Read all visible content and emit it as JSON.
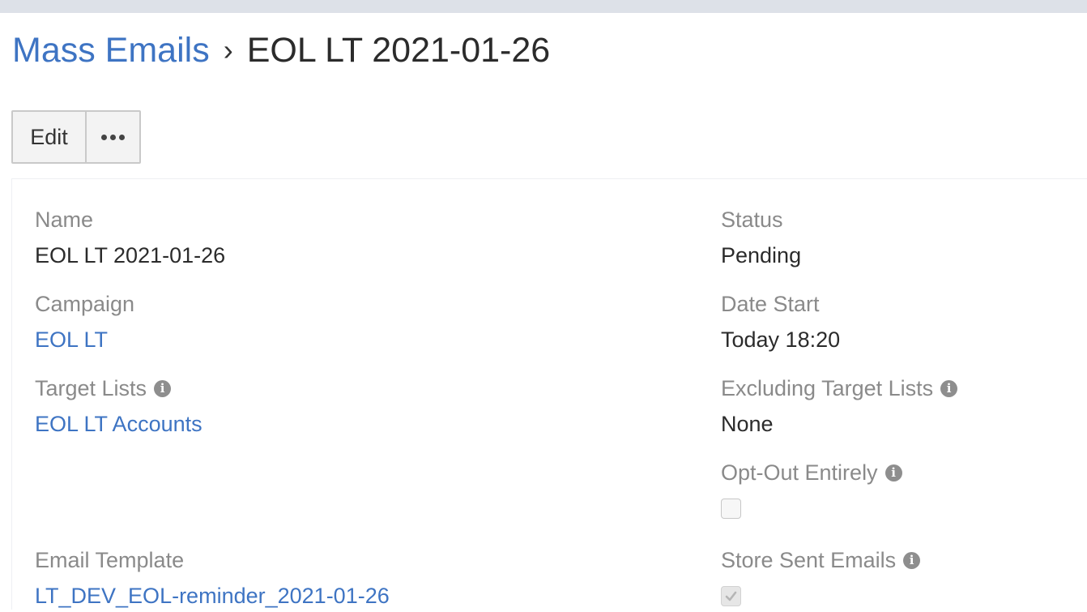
{
  "breadcrumb": {
    "parent_label": "Mass Emails",
    "separator": "›",
    "current_label": "EOL LT 2021-01-26"
  },
  "toolbar": {
    "edit_label": "Edit",
    "more_icon": "ellipsis-icon"
  },
  "fields": {
    "name": {
      "label": "Name",
      "value": "EOL LT 2021-01-26"
    },
    "campaign": {
      "label": "Campaign",
      "value": "EOL LT"
    },
    "target_lists": {
      "label": "Target Lists",
      "value": "EOL LT Accounts",
      "icon": "info-icon"
    },
    "email_template": {
      "label": "Email Template",
      "value": "LT_DEV_EOL-reminder_2021-01-26"
    },
    "status": {
      "label": "Status",
      "value": "Pending"
    },
    "date_start": {
      "label": "Date Start",
      "value": "Today 18:20"
    },
    "excluding_target_lists": {
      "label": "Excluding Target Lists",
      "value": "None",
      "icon": "info-icon"
    },
    "opt_out_entirely": {
      "label": "Opt-Out Entirely",
      "checked": false,
      "icon": "info-icon"
    },
    "store_sent_emails": {
      "label": "Store Sent Emails",
      "checked": true,
      "icon": "info-icon"
    }
  },
  "colors": {
    "link": "#3e74c3",
    "label": "#8a8a8a",
    "text": "#2b2b2b",
    "top_strip": "#dde1e8"
  }
}
